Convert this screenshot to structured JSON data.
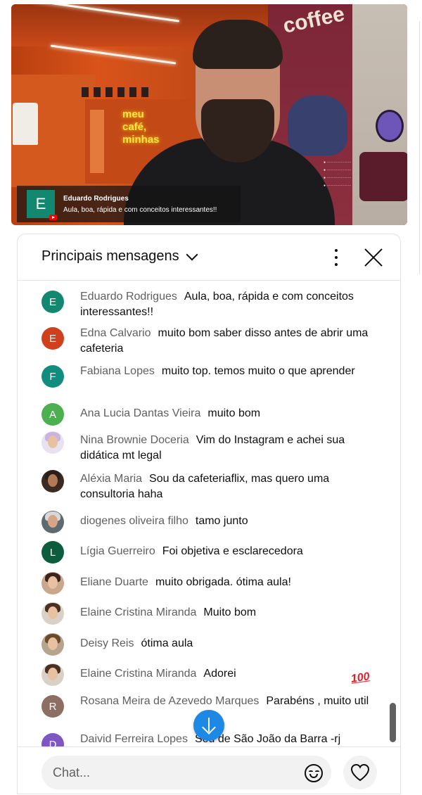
{
  "video": {
    "store_sign": "meu\ncafé,\nminhas",
    "wall_text": "coffee",
    "overlay": {
      "avatar_letter": "E",
      "author": "Eduardo Rodrigues",
      "message": "Aula, boa, rápida e com conceitos interessantes!!"
    }
  },
  "chat": {
    "title": "Principais mensagens",
    "colors": {
      "green": "#138871",
      "red": "#d0401d",
      "teal": "#128c7e",
      "lightgreen": "#4caf50",
      "darkgreen": "#0b5d3d",
      "brown": "#8d6e63",
      "purple": "#7e57c2",
      "accent": "#1e88e5"
    },
    "messages": [
      {
        "author": "Eduardo Rodrigues",
        "text": "Aula, boa, rápida e com conceitos interessantes!!",
        "avatar": "E",
        "avatar_color": "#138871"
      },
      {
        "author": "Edna Calvario",
        "text": "muito bom saber disso antes de abrir uma cafeteria",
        "avatar": "E",
        "avatar_color": "#d0401d"
      },
      {
        "author": "Fabiana Lopes",
        "text": "muito top. temos muito o que aprender",
        "avatar": "F",
        "avatar_color": "#138871"
      },
      {
        "author": "Ana Lucia Dantas Vieira",
        "text": "muito bom",
        "avatar": "A",
        "avatar_color": "#4caf50"
      },
      {
        "author": "Nina Brownie Doceria",
        "text": "Vim do Instagram e achei sua didática mt legal",
        "avatar_photo": "nina-photo"
      },
      {
        "author": "Aléxia Maria",
        "text": "Sou da cafeteriaflix, mas quero uma consultoria haha",
        "avatar_photo": "alexia-photo"
      },
      {
        "author": "diogenes oliveira filho",
        "text": "tamo junto",
        "avatar_photo": "diogenes-photo"
      },
      {
        "author": "Lígia Guerreiro",
        "text": "Foi objetiva e esclarecedora",
        "avatar": "L",
        "avatar_color": "#0b5d3d"
      },
      {
        "author": "Eliane Duarte",
        "text": "muito obrigada. ótima aula!",
        "avatar_photo": "eliane-photo"
      },
      {
        "author": "Elaine Cristina Miranda",
        "text": "Muito bom",
        "avatar_photo": "elaine-photo"
      },
      {
        "author": "Deisy Reis",
        "text": "ótima aula",
        "avatar_photo": "deisy-photo"
      },
      {
        "author": "Elaine Cristina Miranda",
        "text": "Adorei",
        "avatar_photo": "elaine-photo"
      },
      {
        "author": "Rosana Meira de Azevedo Marques",
        "text": "Parabéns , muito util",
        "avatar": "R",
        "avatar_color": "#8d6e63"
      },
      {
        "author": "Daivid Ferreira Lopes",
        "text": "Sou de São João da Barra -rj",
        "avatar": "D",
        "avatar_color": "#7e57c2"
      }
    ],
    "reaction_emoji": "100",
    "input_placeholder": "Chat..."
  }
}
